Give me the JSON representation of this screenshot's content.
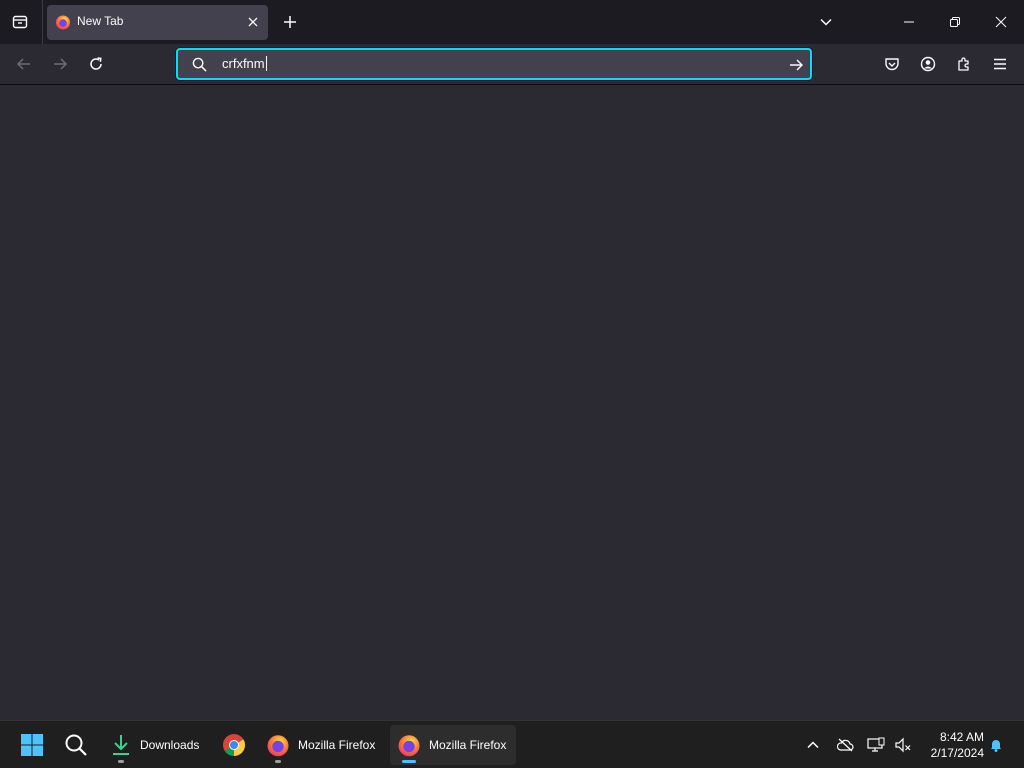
{
  "tabs": [
    {
      "title": "New Tab",
      "active": true
    }
  ],
  "urlbar": {
    "value": "crfxfnm",
    "focused": true
  },
  "colors": {
    "accent": "#00ddff",
    "toolbar_bg": "#2b2a33",
    "tabbar_bg": "#1c1b22",
    "tab_active_bg": "#42414d"
  },
  "toolbar_icons": [
    "back-icon",
    "forward-icon",
    "reload-icon",
    "pocket-icon",
    "account-icon",
    "extensions-icon",
    "menu-icon"
  ],
  "taskbar": {
    "items": [
      {
        "label": "",
        "icon": "windows-start-icon"
      },
      {
        "label": "",
        "icon": "search-icon"
      },
      {
        "label": "Downloads",
        "icon": "downloads-icon"
      },
      {
        "label": "",
        "icon": "chrome-icon"
      },
      {
        "label": "Mozilla Firefox",
        "icon": "firefox-icon"
      },
      {
        "label": "Mozilla Firefox",
        "icon": "firefox-icon",
        "active": true
      }
    ],
    "clock_time": "8:42 AM",
    "clock_date": "2/17/2024"
  }
}
